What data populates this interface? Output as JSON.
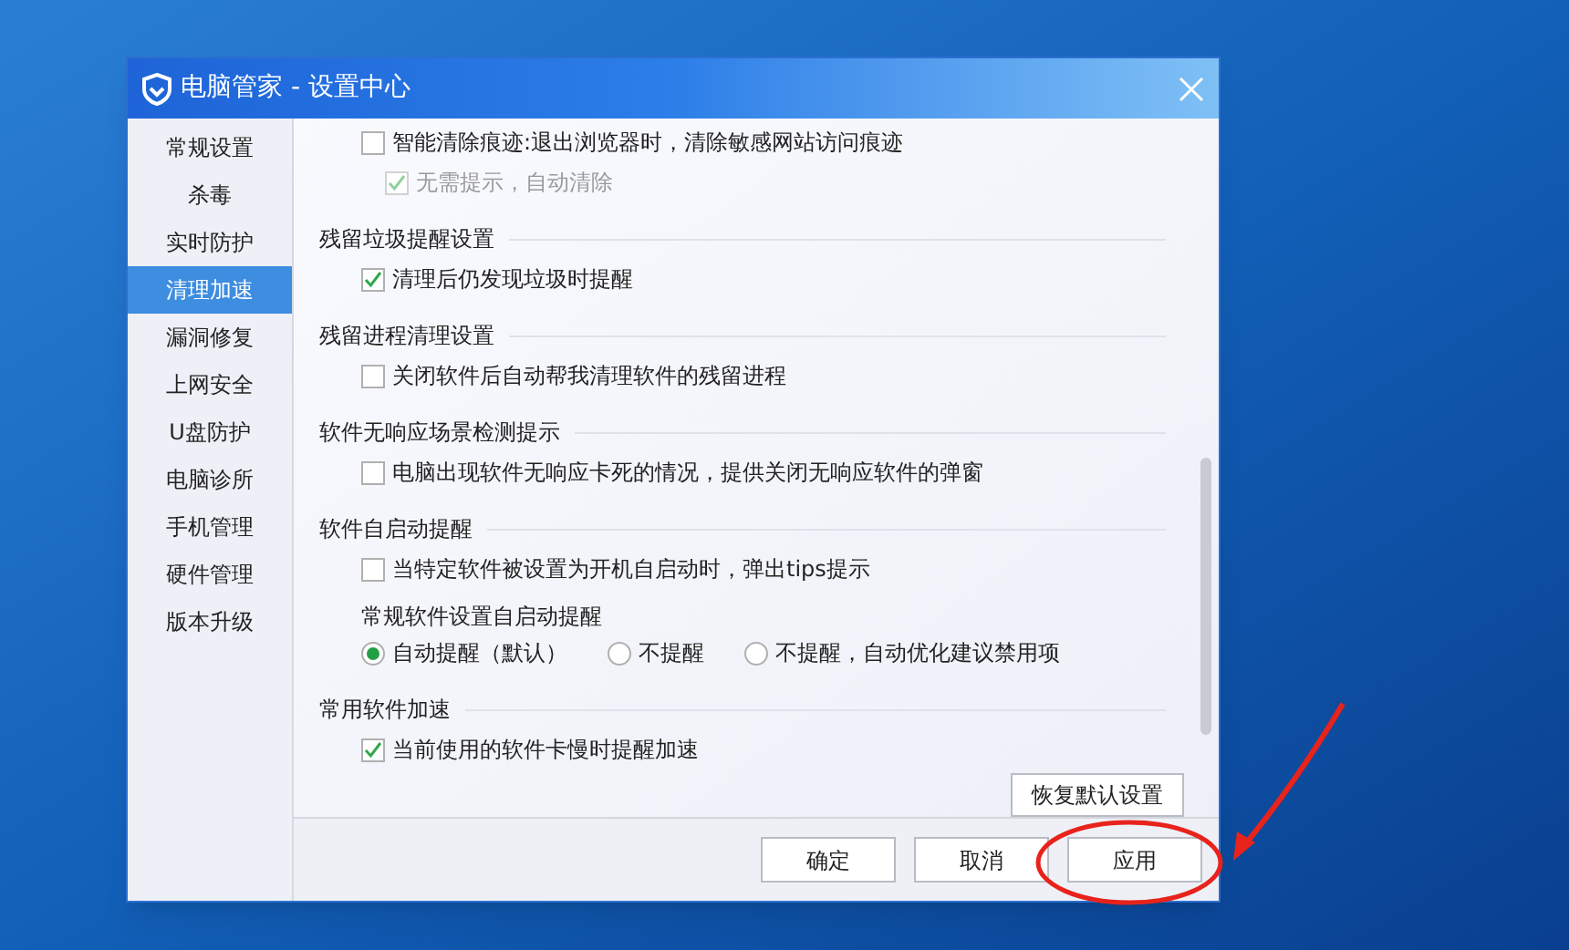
{
  "window": {
    "title": "电脑管家 - 设置中心"
  },
  "sidebar": {
    "items": [
      {
        "label": "常规设置",
        "selected": false
      },
      {
        "label": "杀毒",
        "selected": false
      },
      {
        "label": "实时防护",
        "selected": false
      },
      {
        "label": "清理加速",
        "selected": true
      },
      {
        "label": "漏洞修复",
        "selected": false
      },
      {
        "label": "上网安全",
        "selected": false
      },
      {
        "label": "U盘防护",
        "selected": false
      },
      {
        "label": "电脑诊所",
        "selected": false
      },
      {
        "label": "手机管理",
        "selected": false
      },
      {
        "label": "硬件管理",
        "selected": false
      },
      {
        "label": "版本升级",
        "selected": false
      }
    ]
  },
  "sections": [
    {
      "items": [
        {
          "kind": "checkbox",
          "label": "智能清除痕迹:退出浏览器时，清除敏感网站访问痕迹",
          "checked": false,
          "disabled": false,
          "children": [
            {
              "label": "无需提示，自动清除",
              "checked": true,
              "disabled": true
            }
          ]
        }
      ]
    },
    {
      "title": "残留垃圾提醒设置",
      "items": [
        {
          "kind": "checkbox",
          "label": "清理后仍发现垃圾时提醒",
          "checked": true,
          "disabled": false
        }
      ]
    },
    {
      "title": "残留进程清理设置",
      "items": [
        {
          "kind": "checkbox",
          "label": "关闭软件后自动帮我清理软件的残留进程",
          "checked": false,
          "disabled": false
        }
      ]
    },
    {
      "title": "软件无响应场景检测提示",
      "items": [
        {
          "kind": "checkbox",
          "label": "电脑出现软件无响应卡死的情况，提供关闭无响应软件的弹窗",
          "checked": false,
          "disabled": false
        }
      ]
    },
    {
      "title": "软件自启动提醒",
      "items": [
        {
          "kind": "checkbox",
          "label": "当特定软件被设置为开机自启动时，弹出tips提示",
          "checked": false,
          "disabled": false
        },
        {
          "kind": "subheading",
          "label": "常规软件设置自启动提醒"
        },
        {
          "kind": "radios",
          "options": [
            {
              "label": "自动提醒（默认）",
              "selected": true
            },
            {
              "label": "不提醒",
              "selected": false
            },
            {
              "label": "不提醒，自动优化建议禁用项",
              "selected": false
            }
          ]
        }
      ]
    },
    {
      "title": "常用软件加速",
      "items": [
        {
          "kind": "checkbox",
          "label": "当前使用的软件卡慢时提醒加速",
          "checked": true,
          "disabled": false
        }
      ]
    }
  ],
  "restore_button": "恢复默认设置",
  "footer_buttons": [
    "确定",
    "取消",
    "应用"
  ]
}
